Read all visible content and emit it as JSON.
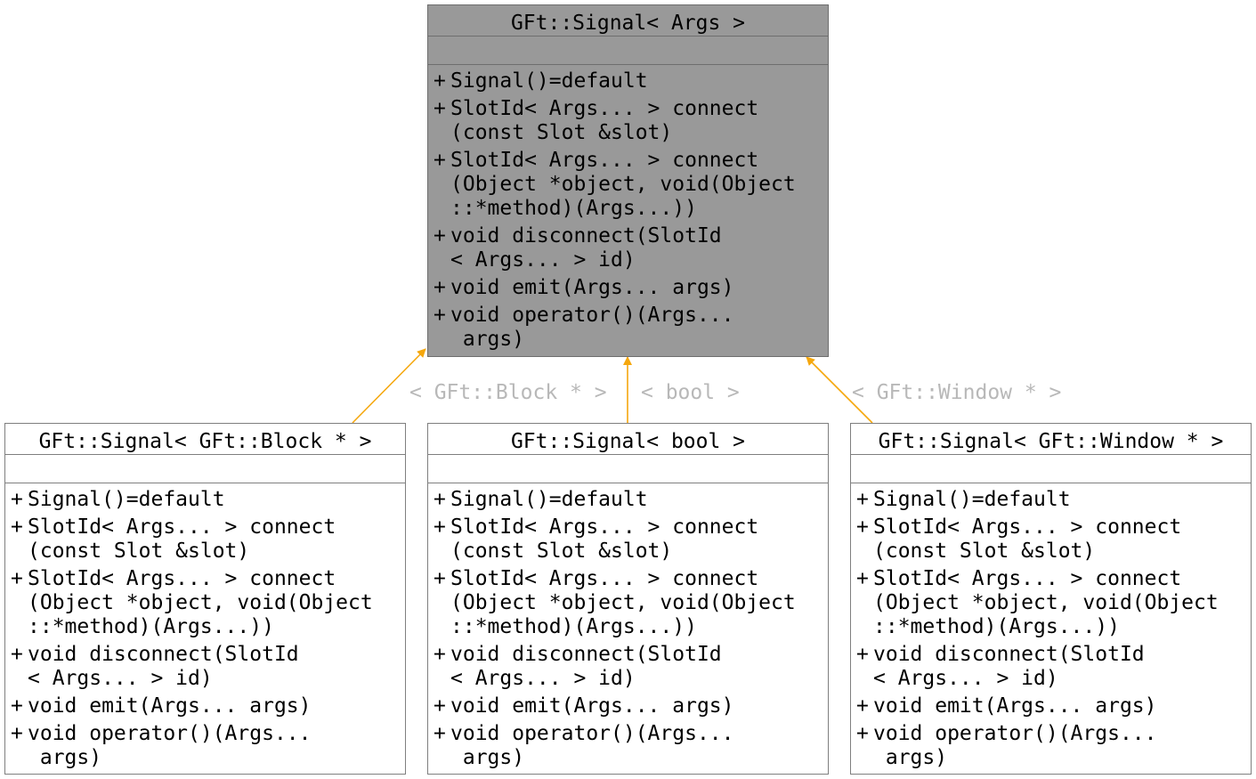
{
  "classes": [
    {
      "id": "base",
      "title": "GFt::Signal< Args >",
      "members": [
        {
          "vis": "+",
          "sig": "Signal()=default"
        },
        {
          "vis": "+",
          "sig": "SlotId< Args... > connect\n(const Slot &slot)"
        },
        {
          "vis": "+",
          "sig": "SlotId< Args... > connect\n(Object *object, void(Object\n::*method)(Args...))"
        },
        {
          "vis": "+",
          "sig": "void disconnect(SlotId\n< Args... > id)"
        },
        {
          "vis": "+",
          "sig": "void emit(Args... args)"
        },
        {
          "vis": "+",
          "sig": "void operator()(Args...\n args)"
        }
      ]
    },
    {
      "id": "block",
      "title": "GFt::Signal< GFt::Block * >",
      "members": [
        {
          "vis": "+",
          "sig": "Signal()=default"
        },
        {
          "vis": "+",
          "sig": "SlotId< Args... > connect\n(const Slot &slot)"
        },
        {
          "vis": "+",
          "sig": "SlotId< Args... > connect\n(Object *object, void(Object\n::*method)(Args...))"
        },
        {
          "vis": "+",
          "sig": "void disconnect(SlotId\n< Args... > id)"
        },
        {
          "vis": "+",
          "sig": "void emit(Args... args)"
        },
        {
          "vis": "+",
          "sig": "void operator()(Args...\n args)"
        }
      ]
    },
    {
      "id": "bool",
      "title": "GFt::Signal< bool >",
      "members": [
        {
          "vis": "+",
          "sig": "Signal()=default"
        },
        {
          "vis": "+",
          "sig": "SlotId< Args... > connect\n(const Slot &slot)"
        },
        {
          "vis": "+",
          "sig": "SlotId< Args... > connect\n(Object *object, void(Object\n::*method)(Args...))"
        },
        {
          "vis": "+",
          "sig": "void disconnect(SlotId\n< Args... > id)"
        },
        {
          "vis": "+",
          "sig": "void emit(Args... args)"
        },
        {
          "vis": "+",
          "sig": "void operator()(Args...\n args)"
        }
      ]
    },
    {
      "id": "window",
      "title": "GFt::Signal< GFt::Window * >",
      "members": [
        {
          "vis": "+",
          "sig": "Signal()=default"
        },
        {
          "vis": "+",
          "sig": "SlotId< Args... > connect\n(const Slot &slot)"
        },
        {
          "vis": "+",
          "sig": "SlotId< Args... > connect\n(Object *object, void(Object\n::*method)(Args...))"
        },
        {
          "vis": "+",
          "sig": "void disconnect(SlotId\n< Args... > id)"
        },
        {
          "vis": "+",
          "sig": "void emit(Args... args)"
        },
        {
          "vis": "+",
          "sig": "void operator()(Args...\n args)"
        }
      ]
    }
  ],
  "edges": [
    {
      "from": "block",
      "to": "base",
      "label": "< GFt::Block * >"
    },
    {
      "from": "bool",
      "to": "base",
      "label": "< bool >"
    },
    {
      "from": "window",
      "to": "base",
      "label": "< GFt::Window * >"
    }
  ],
  "colors": {
    "edge": "#f5a70d",
    "edge_label": "#b8b8b8",
    "template_fill": "#999999",
    "border": "#7f7f7f"
  }
}
